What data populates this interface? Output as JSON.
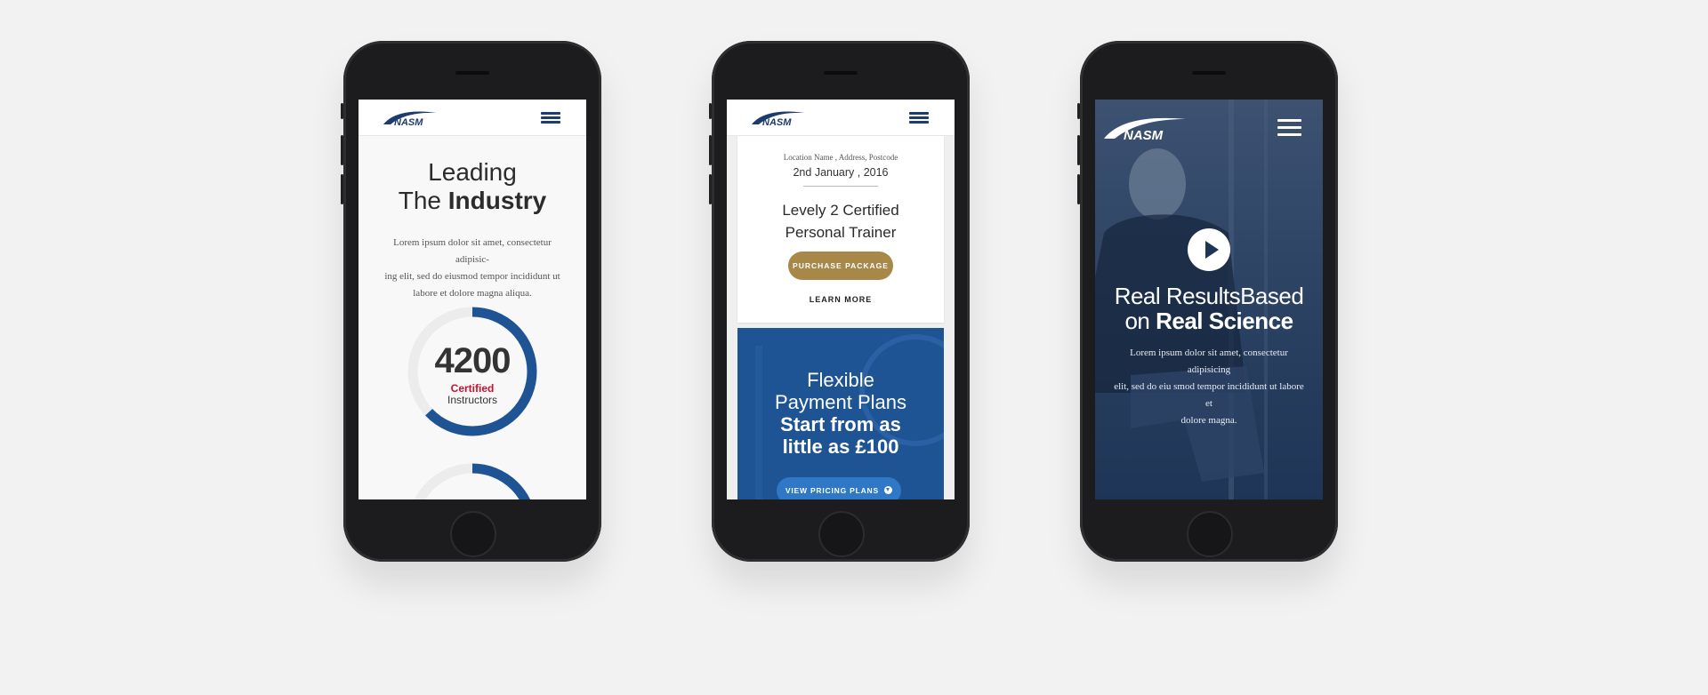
{
  "brand": {
    "logo_text": "NASM",
    "primary": "#1d3b6d",
    "accent_gold": "#a88848",
    "accent_red": "#c8102e",
    "panel_blue": "#1f5494"
  },
  "phone1": {
    "heading_line1": "Leading",
    "heading_line2_pre": "The ",
    "heading_line2_bold": "Industry",
    "paragraph_lines": [
      "Lorem ipsum dolor sit amet, consectetur adipisic-",
      "ing elit, sed do eiusmod tempor incididunt ut",
      "labore et dolore magna aliqua."
    ],
    "stat": {
      "value": "4200",
      "label_highlight": "Certified",
      "label": "Instructors",
      "progress": 0.63
    },
    "stat2_progress": 0.25
  },
  "phone2": {
    "location": "Location Name , Address, Postcode",
    "date": "2nd January , 2016",
    "course_title_line1": "Levely 2 Certified",
    "course_title_line2": "Personal Trainer",
    "purchase_label": "PURCHASE PACKAGE",
    "learn_more_label": "LEARN MORE",
    "promo_line1": "Flexible",
    "promo_line2": "Payment Plans",
    "promo_bold_line1": "Start from as",
    "promo_bold_line2": "little as £100",
    "pricing_label": "VIEW PRICING PLANS"
  },
  "phone3": {
    "title_line1": "Real ResultsBased",
    "title_line2_pre": "on ",
    "title_line2_bold": "Real Science",
    "paragraph_lines": [
      "Lorem ipsum dolor sit amet, consectetur adipisicing",
      "elit, sed do eiu smod tempor incididunt ut labore et",
      "dolore magna."
    ]
  }
}
